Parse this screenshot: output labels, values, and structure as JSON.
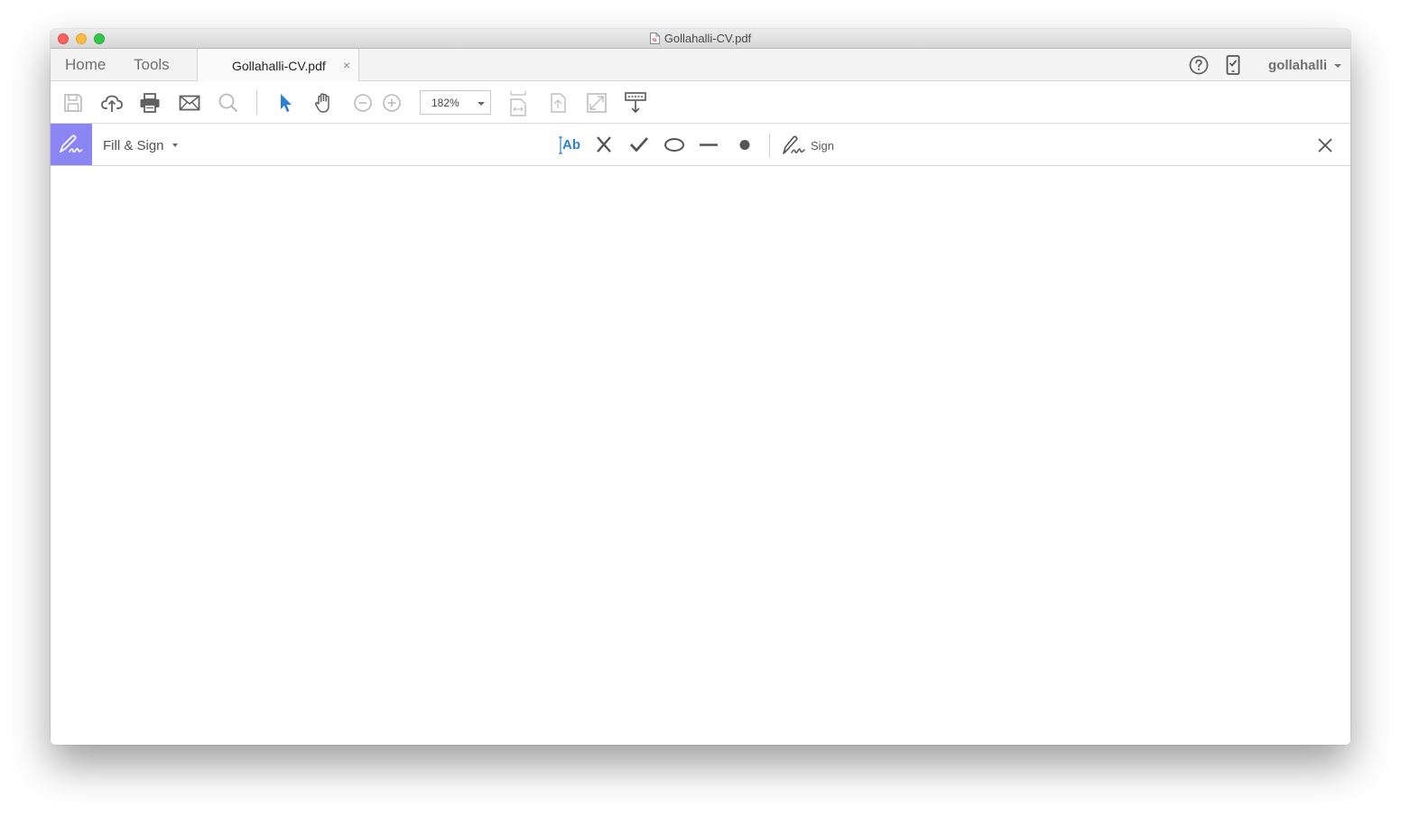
{
  "window": {
    "title": "Gollahalli-CV.pdf"
  },
  "tabbar": {
    "home_label": "Home",
    "tools_label": "Tools",
    "document_tab_label": "Gollahalli-CV.pdf",
    "close_tab_glyph": "×",
    "user_name": "gollahalli"
  },
  "toolbar": {
    "zoom_value": "182%",
    "icons": [
      "save-icon",
      "upload-cloud-icon",
      "print-icon",
      "mail-icon",
      "search-icon",
      "select-pointer-icon",
      "hand-icon",
      "zoom-out-icon",
      "zoom-in-icon",
      "fit-page-icon",
      "page-rotate-icon",
      "fullscreen-icon",
      "keyboard-download-icon"
    ],
    "active_tool_color": "#2e7fd1"
  },
  "fill_sign": {
    "title": "Fill & Sign",
    "text_tool_label": "Ab",
    "sign_label": "Sign",
    "badge_color": "#8b86f3",
    "tools": [
      "add-text-icon",
      "cross-mark-icon",
      "checkmark-icon",
      "ellipse-icon",
      "line-icon",
      "dot-icon",
      "sign-pen-icon"
    ]
  }
}
